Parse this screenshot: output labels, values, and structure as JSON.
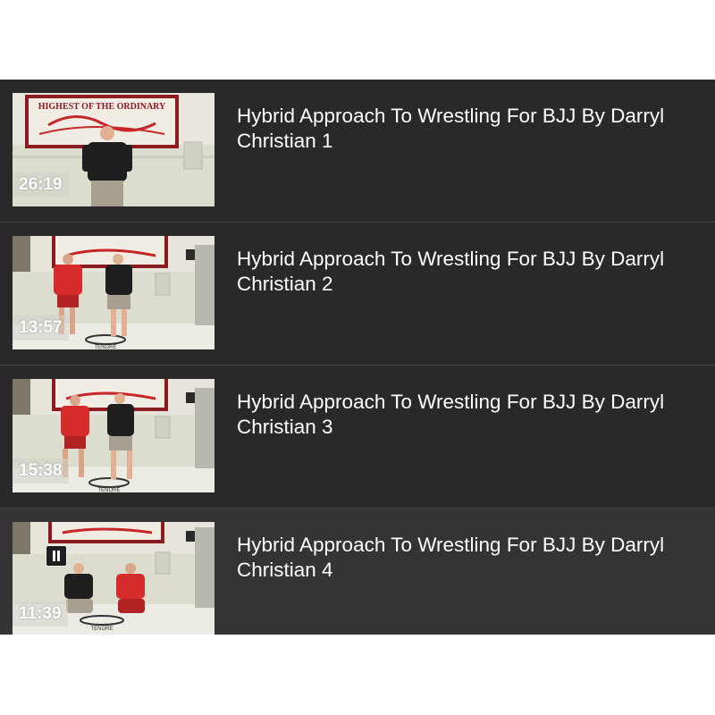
{
  "playlist": {
    "items": [
      {
        "title": "Hybrid Approach To Wrestling For BJJ By Darryl Christian 1",
        "duration": "26:19",
        "thumbnail": "instructor-standing-alone",
        "state": "default"
      },
      {
        "title": "Hybrid Approach To Wrestling For BJJ By Darryl Christian 2",
        "duration": "13:57",
        "thumbnail": "two-standing-facing-camera",
        "state": "default"
      },
      {
        "title": "Hybrid Approach To Wrestling For BJJ By Darryl Christian 3",
        "duration": "15:38",
        "thumbnail": "two-standing-facing-camera",
        "state": "default"
      },
      {
        "title": "Hybrid Approach To Wrestling For BJJ By Darryl Christian 4",
        "duration": "11:39",
        "thumbnail": "two-kneeling",
        "state": "playing"
      }
    ],
    "banner_text": "HIGHEST OF THE ORDINARY",
    "mat_logo_text": "TENORE",
    "colors": {
      "panel_bg": "#2a2828",
      "active_bg": "#353333",
      "divider": "#454343",
      "title_text": "#ffffff",
      "red_shirt": "#d52b2b",
      "black_shirt": "#1e1e1e"
    }
  }
}
